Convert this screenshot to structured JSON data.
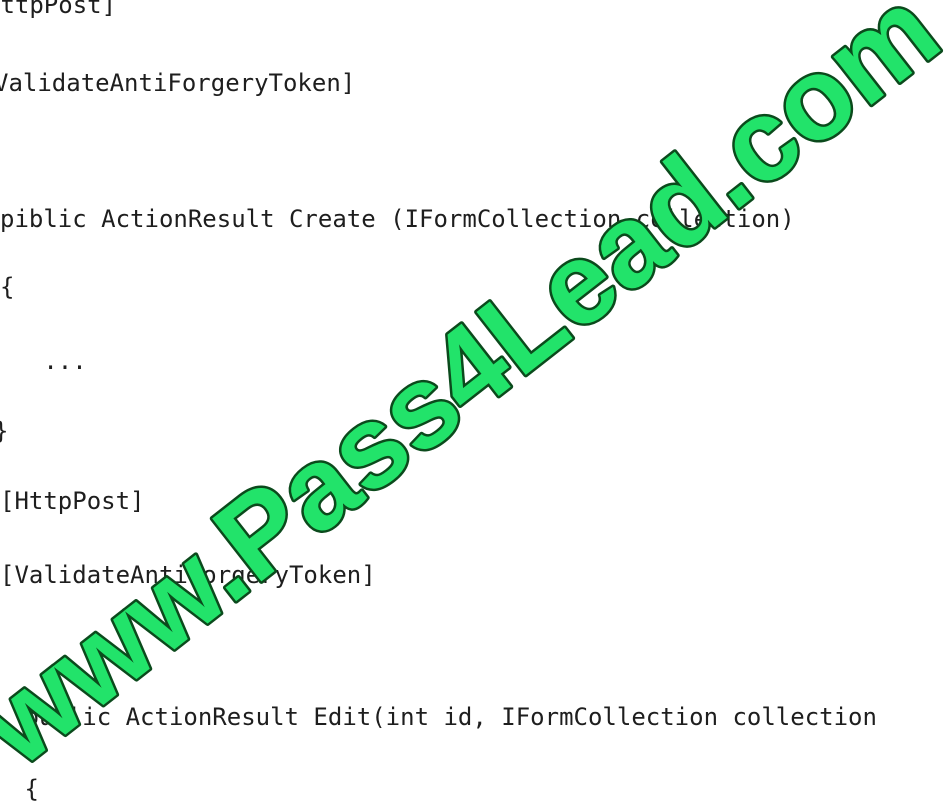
{
  "code": {
    "lines": [
      "HttpPost]",
      "ValidateAntiForgeryToken]",
      "",
      "piblic ActionResult Create (IFormCollection collection)",
      "{",
      "   ...",
      "}",
      "[HttpPost]",
      "[ValidateAntiForgeryToken]",
      "",
      "",
      " public ActionResult Edit(int id, IFormCollection collection",
      " {"
    ]
  },
  "watermark": {
    "text": "www.Pass4Lead.com",
    "fill_color": "#22e36a",
    "outline_color": "#0b4a1c"
  }
}
